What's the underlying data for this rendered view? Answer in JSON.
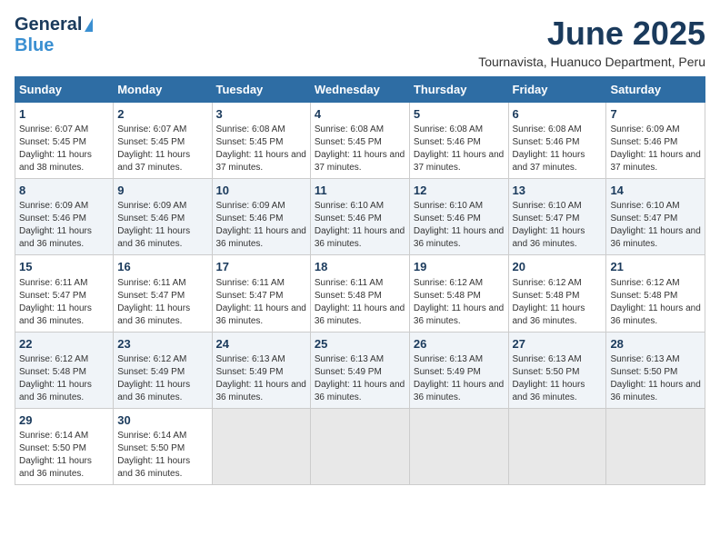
{
  "header": {
    "logo_general": "General",
    "logo_blue": "Blue",
    "month": "June 2025",
    "location": "Tournavista, Huanuco Department, Peru"
  },
  "calendar": {
    "days_of_week": [
      "Sunday",
      "Monday",
      "Tuesday",
      "Wednesday",
      "Thursday",
      "Friday",
      "Saturday"
    ],
    "weeks": [
      [
        {
          "day": "1",
          "sunrise": "6:07 AM",
          "sunset": "5:45 PM",
          "daylight": "11 hours and 38 minutes."
        },
        {
          "day": "2",
          "sunrise": "6:07 AM",
          "sunset": "5:45 PM",
          "daylight": "11 hours and 37 minutes."
        },
        {
          "day": "3",
          "sunrise": "6:08 AM",
          "sunset": "5:45 PM",
          "daylight": "11 hours and 37 minutes."
        },
        {
          "day": "4",
          "sunrise": "6:08 AM",
          "sunset": "5:45 PM",
          "daylight": "11 hours and 37 minutes."
        },
        {
          "day": "5",
          "sunrise": "6:08 AM",
          "sunset": "5:46 PM",
          "daylight": "11 hours and 37 minutes."
        },
        {
          "day": "6",
          "sunrise": "6:08 AM",
          "sunset": "5:46 PM",
          "daylight": "11 hours and 37 minutes."
        },
        {
          "day": "7",
          "sunrise": "6:09 AM",
          "sunset": "5:46 PM",
          "daylight": "11 hours and 37 minutes."
        }
      ],
      [
        {
          "day": "8",
          "sunrise": "6:09 AM",
          "sunset": "5:46 PM",
          "daylight": "11 hours and 36 minutes."
        },
        {
          "day": "9",
          "sunrise": "6:09 AM",
          "sunset": "5:46 PM",
          "daylight": "11 hours and 36 minutes."
        },
        {
          "day": "10",
          "sunrise": "6:09 AM",
          "sunset": "5:46 PM",
          "daylight": "11 hours and 36 minutes."
        },
        {
          "day": "11",
          "sunrise": "6:10 AM",
          "sunset": "5:46 PM",
          "daylight": "11 hours and 36 minutes."
        },
        {
          "day": "12",
          "sunrise": "6:10 AM",
          "sunset": "5:46 PM",
          "daylight": "11 hours and 36 minutes."
        },
        {
          "day": "13",
          "sunrise": "6:10 AM",
          "sunset": "5:47 PM",
          "daylight": "11 hours and 36 minutes."
        },
        {
          "day": "14",
          "sunrise": "6:10 AM",
          "sunset": "5:47 PM",
          "daylight": "11 hours and 36 minutes."
        }
      ],
      [
        {
          "day": "15",
          "sunrise": "6:11 AM",
          "sunset": "5:47 PM",
          "daylight": "11 hours and 36 minutes."
        },
        {
          "day": "16",
          "sunrise": "6:11 AM",
          "sunset": "5:47 PM",
          "daylight": "11 hours and 36 minutes."
        },
        {
          "day": "17",
          "sunrise": "6:11 AM",
          "sunset": "5:47 PM",
          "daylight": "11 hours and 36 minutes."
        },
        {
          "day": "18",
          "sunrise": "6:11 AM",
          "sunset": "5:48 PM",
          "daylight": "11 hours and 36 minutes."
        },
        {
          "day": "19",
          "sunrise": "6:12 AM",
          "sunset": "5:48 PM",
          "daylight": "11 hours and 36 minutes."
        },
        {
          "day": "20",
          "sunrise": "6:12 AM",
          "sunset": "5:48 PM",
          "daylight": "11 hours and 36 minutes."
        },
        {
          "day": "21",
          "sunrise": "6:12 AM",
          "sunset": "5:48 PM",
          "daylight": "11 hours and 36 minutes."
        }
      ],
      [
        {
          "day": "22",
          "sunrise": "6:12 AM",
          "sunset": "5:48 PM",
          "daylight": "11 hours and 36 minutes."
        },
        {
          "day": "23",
          "sunrise": "6:12 AM",
          "sunset": "5:49 PM",
          "daylight": "11 hours and 36 minutes."
        },
        {
          "day": "24",
          "sunrise": "6:13 AM",
          "sunset": "5:49 PM",
          "daylight": "11 hours and 36 minutes."
        },
        {
          "day": "25",
          "sunrise": "6:13 AM",
          "sunset": "5:49 PM",
          "daylight": "11 hours and 36 minutes."
        },
        {
          "day": "26",
          "sunrise": "6:13 AM",
          "sunset": "5:49 PM",
          "daylight": "11 hours and 36 minutes."
        },
        {
          "day": "27",
          "sunrise": "6:13 AM",
          "sunset": "5:50 PM",
          "daylight": "11 hours and 36 minutes."
        },
        {
          "day": "28",
          "sunrise": "6:13 AM",
          "sunset": "5:50 PM",
          "daylight": "11 hours and 36 minutes."
        }
      ],
      [
        {
          "day": "29",
          "sunrise": "6:14 AM",
          "sunset": "5:50 PM",
          "daylight": "11 hours and 36 minutes."
        },
        {
          "day": "30",
          "sunrise": "6:14 AM",
          "sunset": "5:50 PM",
          "daylight": "11 hours and 36 minutes."
        },
        {
          "day": "",
          "sunrise": "",
          "sunset": "",
          "daylight": ""
        },
        {
          "day": "",
          "sunrise": "",
          "sunset": "",
          "daylight": ""
        },
        {
          "day": "",
          "sunrise": "",
          "sunset": "",
          "daylight": ""
        },
        {
          "day": "",
          "sunrise": "",
          "sunset": "",
          "daylight": ""
        },
        {
          "day": "",
          "sunrise": "",
          "sunset": "",
          "daylight": ""
        }
      ]
    ]
  },
  "labels": {
    "sunrise": "Sunrise:",
    "sunset": "Sunset:",
    "daylight": "Daylight:"
  }
}
